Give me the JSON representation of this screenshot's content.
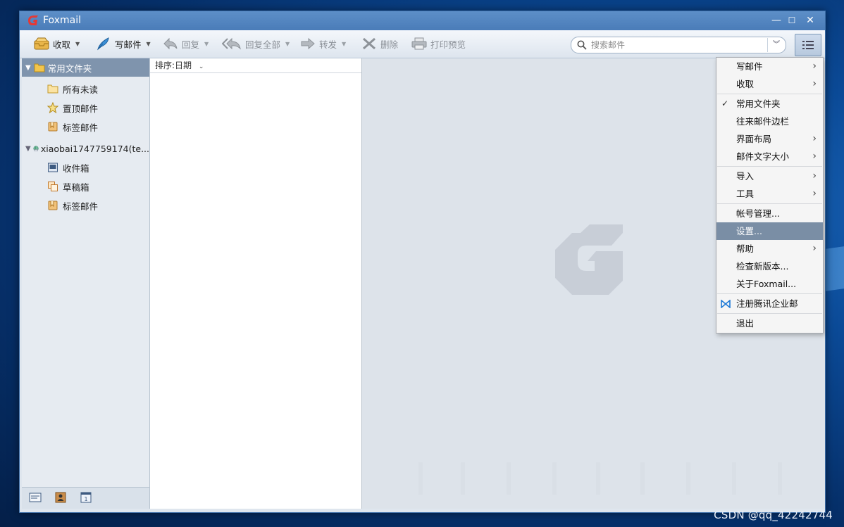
{
  "app": {
    "title": "Foxmail"
  },
  "window_controls": {
    "minimize": "—",
    "maximize": "☐",
    "close": "✕"
  },
  "toolbar": {
    "receive": "收取",
    "compose": "写邮件",
    "reply": "回复",
    "reply_all": "回复全部",
    "forward": "转发",
    "delete": "删除",
    "print_preview": "打印预览"
  },
  "search": {
    "placeholder": "搜索邮件"
  },
  "sidebar": {
    "header": "常用文件夹",
    "favorites": [
      "所有未读",
      "置顶邮件",
      "标签邮件"
    ],
    "account": "xiaobai1747759174(te...",
    "account_folders": [
      "收件箱",
      "草稿箱",
      "标签邮件"
    ]
  },
  "list": {
    "sort_label": "排序:日期"
  },
  "menu": {
    "items": [
      {
        "label": "写邮件",
        "submenu": true
      },
      {
        "label": "收取",
        "submenu": true
      },
      {
        "label": "常用文件夹",
        "checked": true
      },
      {
        "label": "往来邮件边栏"
      },
      {
        "label": "界面布局",
        "submenu": true
      },
      {
        "label": "邮件文字大小",
        "submenu": true
      },
      {
        "label": "导入",
        "submenu": true
      },
      {
        "label": "工具",
        "submenu": true
      },
      {
        "label": "帐号管理..."
      },
      {
        "label": "设置...",
        "highlighted": true
      },
      {
        "label": "帮助",
        "submenu": true
      },
      {
        "label": "检查新版本..."
      },
      {
        "label": "关于Foxmail..."
      },
      {
        "label": "注册腾讯企业邮"
      },
      {
        "label": "退出"
      }
    ],
    "checkmark": "✓",
    "submenu_arrow": "›"
  },
  "desktop": {
    "watermark": "CSDN @qq_42242744"
  },
  "colors": {
    "accent": "#4a7cb8",
    "menu_highlight": "#7a8ea5",
    "folder_header": "#7f94ad"
  }
}
